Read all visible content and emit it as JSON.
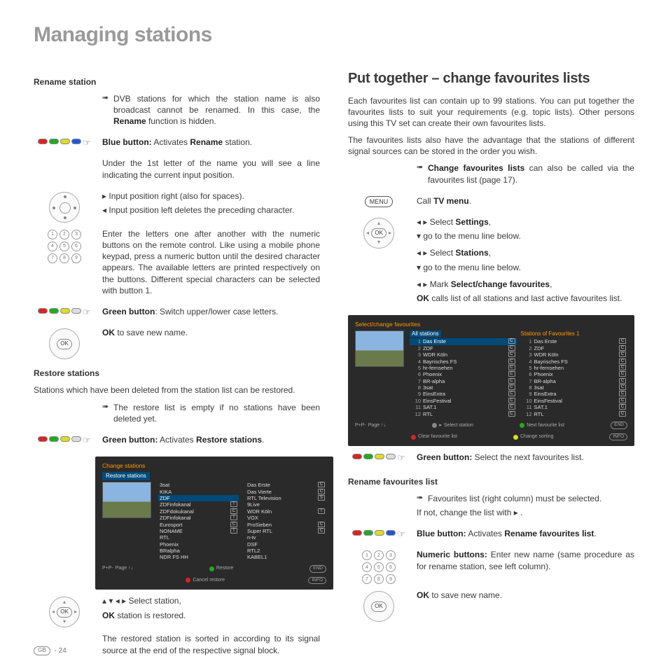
{
  "page": {
    "title": "Managing stations",
    "footer_region": "GB",
    "footer_page": "- 24"
  },
  "left": {
    "rename_heading": "Rename station",
    "dvb_note": "DVB stations for which the station name is also broadcast cannot be renamed. In this case, the Rename function is hidden.",
    "blue_button_lead": "Blue button:",
    "blue_button_text": " Activates Rename station.",
    "under_first": "Under the 1st letter of the name you will see a line indicating the current input position.",
    "input_right": "Input position right (also for spaces).",
    "input_left": "Input position left deletes the preceding character.",
    "enter_letters": "Enter the letters one after another with the numeric buttons on the remote control. Like using a mobile phone keypad, press a numeric button until the desired character appears. The available letters are printed respectively on the buttons. Different special characters can be selected with button 1.",
    "green_switch_lead": "Green button",
    "green_switch_text": ": Switch upper/lower case letters.",
    "ok_save_lead": "OK",
    "ok_save_text": "  to save new name.",
    "restore_heading": "Restore stations",
    "restore_intro": "Stations which have been deleted from the station list can be restored.",
    "restore_empty": "The restore list is empty if no stations have been deleted yet.",
    "green_restore_lead": "Green button:",
    "green_restore_text": " Activates Restore stations.",
    "select_station_text": "Select station,",
    "ok_restored_lead": "OK",
    "ok_restored_text": "  station is restored.",
    "restore_sorted": "The restored station is sorted in according to its signal source at the end of the respective signal block.",
    "tv1": {
      "title": "Change stations",
      "subtitle": "Restore stations",
      "colA": [
        "3sat",
        "KIKA",
        "ZDF",
        "ZDFinfokanal",
        "ZDFdokukanal",
        "ZDFinfokanal",
        "Eurosport",
        "NONAME",
        "RTL",
        "Phoenix",
        "BRalpha",
        "NDR FS HH"
      ],
      "colB": [
        "Das Erste",
        "Das Vierte",
        "RTL Television",
        "9Live",
        "WDR Köln",
        "VOX",
        "ProSieben",
        "Super RTL",
        "n-tv",
        "DSF",
        "RTL2",
        "KABEL1"
      ],
      "foot_restore": "Restore",
      "foot_cancel": "Cancel restore",
      "foot_page": "Page ↑↓",
      "foot_end": "END",
      "foot_info": "INFO"
    }
  },
  "right": {
    "heading": "Put together – change favourites lists",
    "intro1": "Each favourites list can contain up to 99 stations. You can put together the favourites lists to suit your requirements (e.g. topic lists). Other persons using this TV set can create their own favourites lists.",
    "intro2": "The favourites lists also have the advantage that the stations of different signal sources can be stored in the order you wish.",
    "change_note_lead": "Change favourites lists",
    "change_note_text": " can also be called via the favourites list (page 17).",
    "menu_label": "MENU",
    "call_tv_menu": "Call TV menu.",
    "sel_settings": "Select Settings,",
    "goto_line": "  go to the menu line below.",
    "sel_stations": "Select Stations,",
    "mark_sel_change": "Mark Select/change favourites,",
    "ok_calls_lead": "OK",
    "ok_calls_text": "  calls list of all stations and last active favourites list.",
    "tv2": {
      "title": "Select/change favourites",
      "headA": "All stations",
      "headB": "Stations of Favourites 1",
      "list": [
        {
          "n": "1",
          "name": "Das Erste"
        },
        {
          "n": "2",
          "name": "ZDF"
        },
        {
          "n": "3",
          "name": "WDR Köln"
        },
        {
          "n": "4",
          "name": "Bayrisches FS"
        },
        {
          "n": "5",
          "name": "hr-fernsehen"
        },
        {
          "n": "6",
          "name": "Phoenix"
        },
        {
          "n": "7",
          "name": "BR-alpha"
        },
        {
          "n": "8",
          "name": "3sat"
        },
        {
          "n": "9",
          "name": "EinsExtra"
        },
        {
          "n": "10",
          "name": "EinsFestival"
        },
        {
          "n": "11",
          "name": "SAT.1"
        },
        {
          "n": "12",
          "name": "RTL"
        }
      ],
      "f_select": "Select station",
      "f_clear": "Clear favourite list",
      "f_next": "Next favourite list",
      "f_sort": "Change sorting",
      "foot_page": "Page ↑↓",
      "foot_end": "END",
      "foot_ok": "OK",
      "foot_info": "INFO"
    },
    "green_next_lead": "Green button:",
    "green_next_text": " Select the next favourites list.",
    "rename_fav_heading": "Rename favourites list",
    "fav_note1": "Favourites list (right column) must be selected.",
    "fav_note2": "If not, change the list with  ▸ .",
    "blue_fav_lead": "Blue button:",
    "blue_fav_text": " Activates Rename favourites list.",
    "numeric_lead": "Numeric buttons:",
    "numeric_text": " Enter new name (same procedure as for rename station, see left column).",
    "ok_save_lead": "OK",
    "ok_save_text": "  to save new name."
  }
}
